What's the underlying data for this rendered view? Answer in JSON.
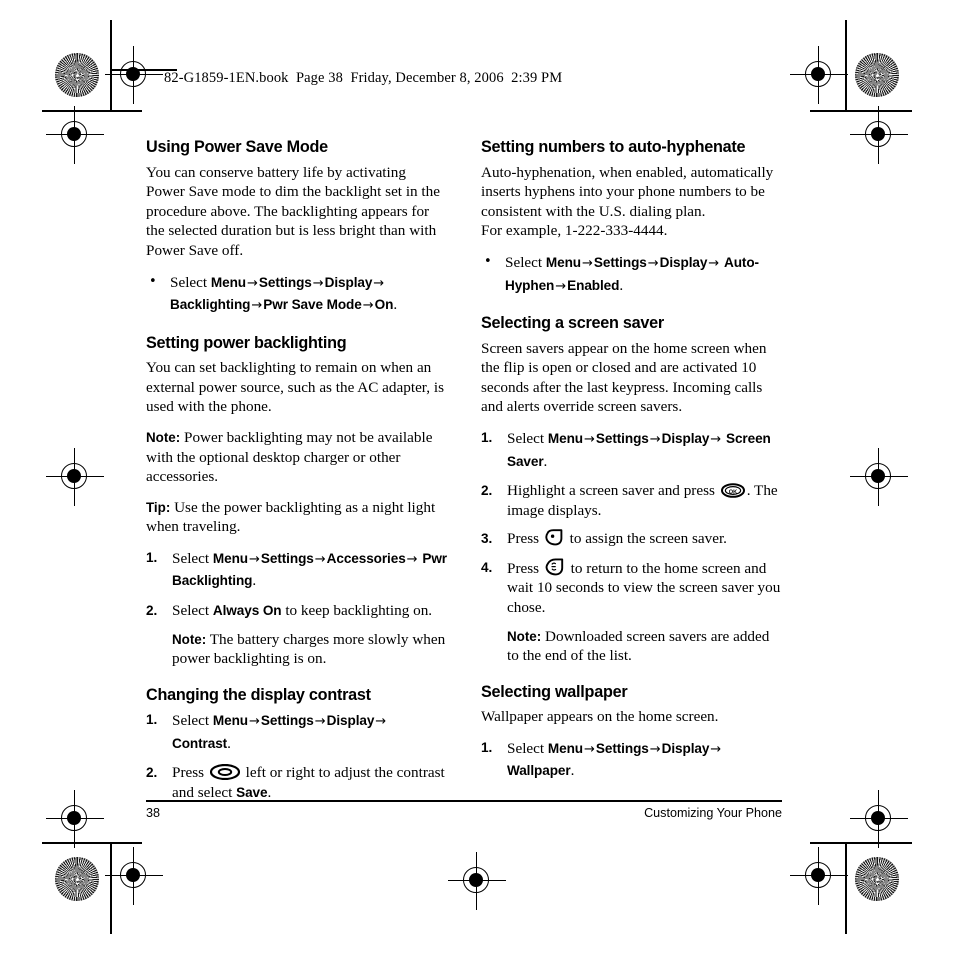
{
  "header": {
    "file_line": "82-G1859-1EN.book  Page 38  Friday, December 8, 2006  2:39 PM"
  },
  "footer": {
    "page_number": "38",
    "chapter": "Customizing Your Phone"
  },
  "icons": {
    "nav_key": "navigation-key-icon",
    "ok_key": "ok-key-icon",
    "ok_key_label": "OK",
    "select_key": "select-softkey-icon",
    "end_key": "end-call-key-icon",
    "registration_cross": "registration-crosshair-mark",
    "registration_star": "registration-star-target-mark"
  },
  "left_column": {
    "section1": {
      "heading": "Using Power Save Mode",
      "paragraph": "You can conserve battery life by activating Power Save mode to dim the backlight set in the procedure above. The backlighting appears for the selected duration but is less bright than with Power Save off.",
      "bullet": {
        "marker": "•",
        "lead": "Select ",
        "p1": "Menu",
        "p2": "Settings",
        "p3": "Display",
        "p4": "Backlighting",
        "p5": "Pwr Save Mode",
        "p6": "On",
        "tail": "."
      }
    },
    "section2": {
      "heading": "Setting power backlighting",
      "paragraph": "You can set backlighting to remain on when an external power source, such as the AC adapter, is used with the phone.",
      "note_label": "Note:",
      "note_text": "  Power backlighting may not be available with the optional desktop charger or other accessories.",
      "tip_label": "Tip:",
      "tip_text": "  Use the power backlighting as a night light when traveling.",
      "step1": {
        "marker": "1.",
        "lead": "Select ",
        "p1": "Menu",
        "p2": "Settings",
        "p3": "Accessories",
        "p4": "Pwr Backlighting",
        "tail": "."
      },
      "step2": {
        "marker": "2.",
        "lead": "Select ",
        "p1": "Always On",
        "tail": " to keep backlighting on."
      },
      "step2_note_label": "Note:",
      "step2_note_text": "  The battery charges more slowly when power backlighting is on."
    },
    "section3": {
      "heading": "Changing the display contrast",
      "step1": {
        "marker": "1.",
        "lead": "Select ",
        "p1": "Menu",
        "p2": "Settings",
        "p3": "Display",
        "p4": "Contrast",
        "tail": "."
      },
      "step2": {
        "marker": "2.",
        "lead": "Press ",
        "mid": " left or right to adjust the contrast and select ",
        "p1": "Save",
        "tail": "."
      }
    }
  },
  "right_column": {
    "section1": {
      "heading": "Setting numbers to auto-hyphenate",
      "paragraph": "Auto-hyphenation, when enabled, automatically inserts hyphens into your phone numbers to be consistent with the U.S. dialing plan.",
      "paragraph2": "For example, 1-222-333-4444.",
      "bullet": {
        "marker": "•",
        "lead": "Select ",
        "p1": "Menu",
        "p2": "Settings",
        "p3": "Display",
        "p4": "Auto-Hyphen",
        "p5": "Enabled",
        "tail": "."
      }
    },
    "section2": {
      "heading": "Selecting a screen saver",
      "paragraph": "Screen savers appear on the home screen when the flip is open or closed and are activated 10 seconds after the last keypress. Incoming calls and alerts override screen savers.",
      "step1": {
        "marker": "1.",
        "lead": "Select ",
        "p1": "Menu",
        "p2": "Settings",
        "p3": "Display",
        "p4": "Screen Saver",
        "tail": "."
      },
      "step2": {
        "marker": "2.",
        "lead": "Highlight a screen saver and press ",
        "tail": ". The image displays."
      },
      "step3": {
        "marker": "3.",
        "lead": "Press ",
        "tail": " to assign the screen saver."
      },
      "step4": {
        "marker": "4.",
        "lead": "Press ",
        "tail": " to return to the home screen and wait 10 seconds to view the screen saver you chose."
      },
      "note_label": "Note:",
      "note_text": "  Downloaded screen savers are added to the end of the list."
    },
    "section3": {
      "heading": "Selecting wallpaper",
      "paragraph": "Wallpaper appears on the home screen.",
      "step1": {
        "marker": "1.",
        "lead": "Select ",
        "p1": "Menu",
        "p2": "Settings",
        "p3": "Display",
        "p4": "Wallpaper",
        "tail": "."
      }
    }
  }
}
